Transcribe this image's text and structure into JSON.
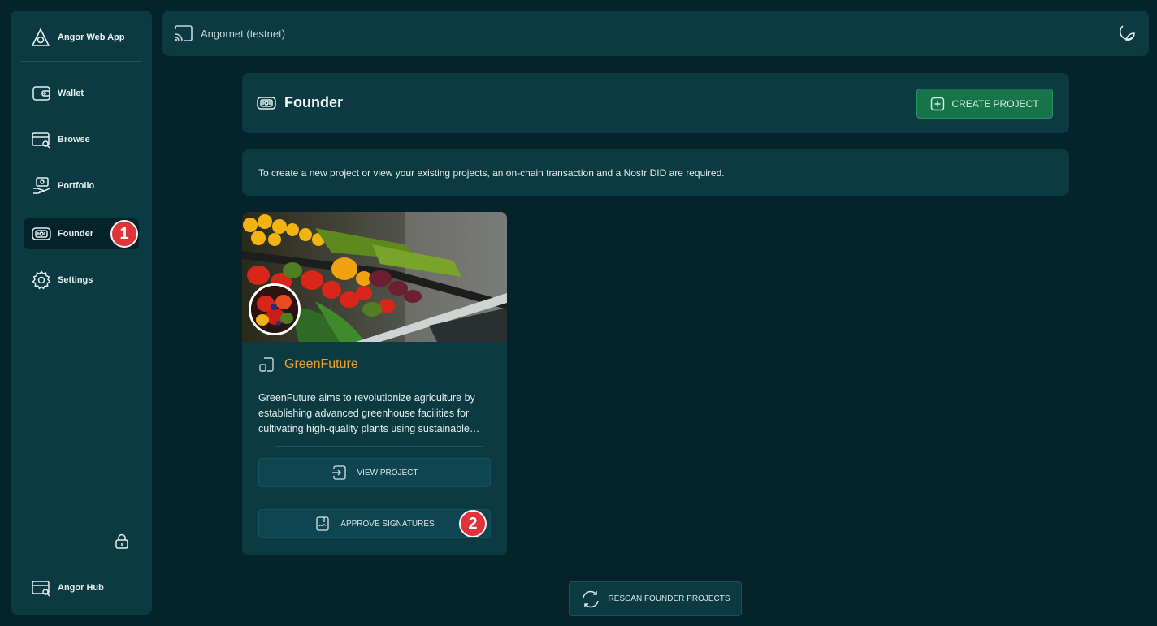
{
  "sidebar": {
    "brand": "Angor Web App",
    "items": [
      {
        "label": "Wallet",
        "icon": "wallet-icon"
      },
      {
        "label": "Browse",
        "icon": "browse-icon"
      },
      {
        "label": "Portfolio",
        "icon": "portfolio-icon"
      },
      {
        "label": "Founder",
        "icon": "founder-icon",
        "active": true
      },
      {
        "label": "Settings",
        "icon": "gear-icon"
      }
    ],
    "hub_label": "Angor Hub"
  },
  "topbar": {
    "network": "Angornet (testnet)"
  },
  "header": {
    "title": "Founder",
    "create_label": "CREATE PROJECT"
  },
  "info": {
    "text": "To create a new project or view your existing projects, an on-chain transaction and a Nostr DID are required."
  },
  "project": {
    "name": "GreenFuture",
    "description": "GreenFuture aims to revolutionize agriculture by establishing advanced greenhouse facilities for cultivating high-quality plants using sustainable…",
    "view_label": "VIEW PROJECT",
    "approve_label": "APPROVE SIGNATURES"
  },
  "rescan_label": "RESCAN FOUNDER PROJECTS",
  "annotations": {
    "badge1": "1",
    "badge2": "2"
  },
  "colors": {
    "background": "#04232a",
    "panel": "#0b3a43",
    "accent_green": "#17734a",
    "project_name": "#f0a02a",
    "badge_red": "#e0333a"
  }
}
